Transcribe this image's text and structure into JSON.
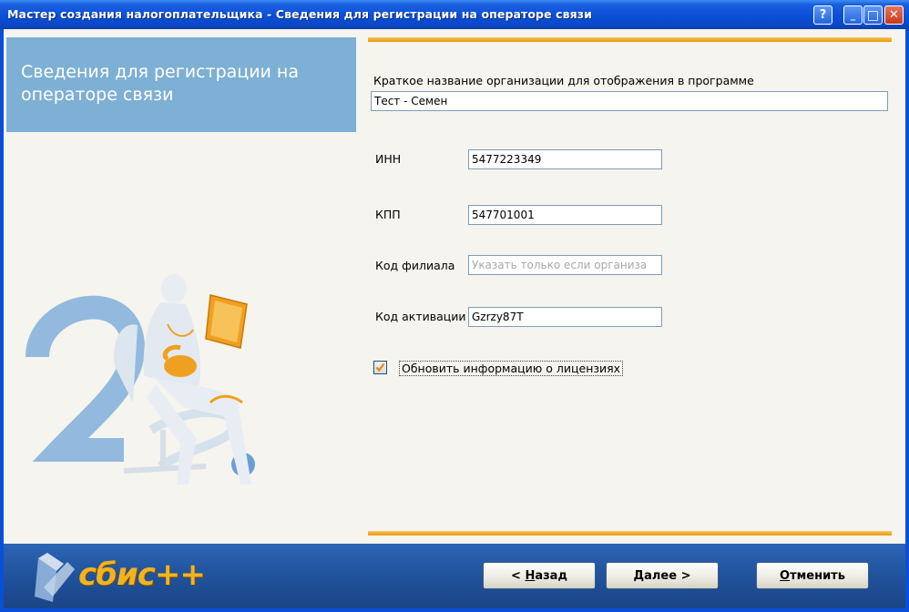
{
  "window": {
    "title": "Мастер создания налогоплательщика - Сведения для регистрации на операторе связи"
  },
  "titlebar_buttons": {
    "help": "?",
    "minimize": "_",
    "maximize": "□",
    "close": "✕"
  },
  "header": {
    "title": "Сведения для регистрации на операторе связи"
  },
  "form": {
    "short_name_label": "Краткое название организации для отображения в программе",
    "short_name_value": "Тест - Семен",
    "inn_label": "ИНН",
    "inn_value": "5477223349",
    "kpp_label": "КПП",
    "kpp_value": "547701001",
    "branch_label": "Код филиала",
    "branch_placeholder": "Указать только если организа",
    "activation_label": "Код активации",
    "activation_value": "Gzrzy87T",
    "update_licenses_label": "Обновить информацию о лицензиях",
    "update_licenses_checked": true
  },
  "footer": {
    "logo": "сбис++",
    "back": {
      "arrow": "<",
      "hot": "Н",
      "rest": "азад"
    },
    "next": {
      "hot": "Д",
      "rest": "алее",
      "arrow": ">"
    },
    "cancel": {
      "hot": "О",
      "rest": "тменить"
    }
  },
  "colors": {
    "title_bar": "#0c4fd6",
    "header_panel": "#7eafd4",
    "accent_line": "#f0a81f",
    "footer": "#1f4f98",
    "illustration_orange": "#f0a020"
  }
}
